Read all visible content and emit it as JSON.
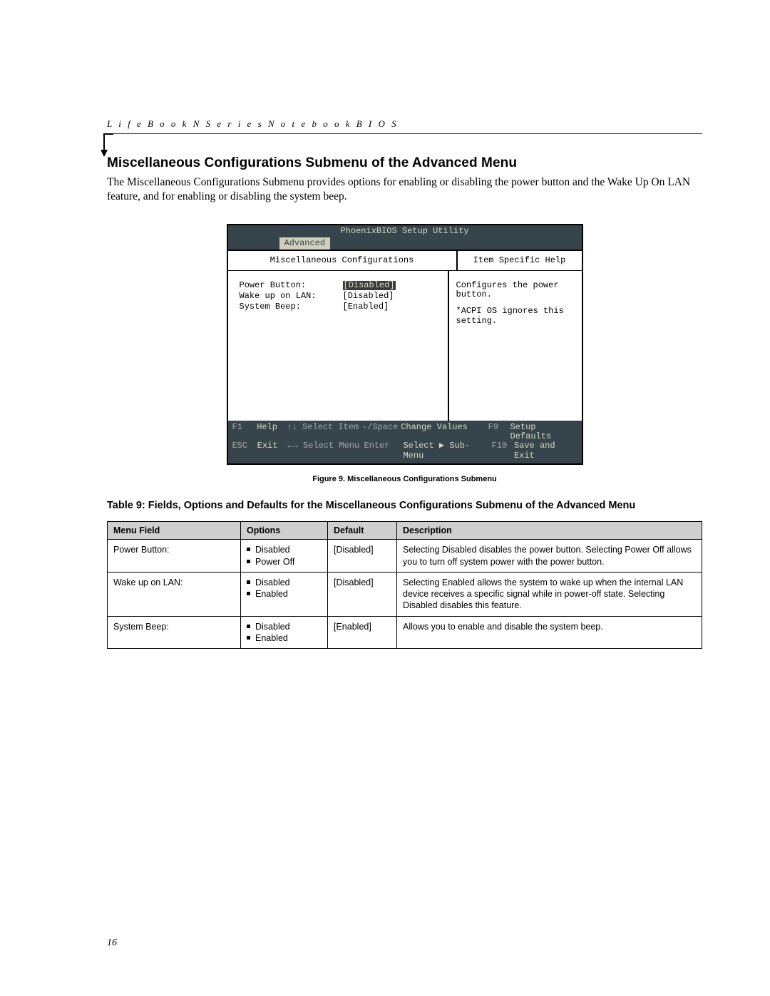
{
  "header": "L i f e B o o k   N   S e r i e s   N o t e b o o k   B I O S",
  "section_title": "Miscellaneous Configurations Submenu of the Advanced Menu",
  "section_body": "The Miscellaneous Configurations Submenu provides options for enabling or disabling the power button and the Wake Up On LAN feature, and for enabling or disabling the system beep.",
  "bios": {
    "title": "PhoenixBIOS Setup Utility",
    "active_tab": "Advanced",
    "panel_title_left": "Miscellaneous Configurations",
    "panel_title_right": "Item Specific Help",
    "rows": [
      {
        "label": "Power Button:",
        "value": "[Disabled]",
        "selected": true
      },
      {
        "label": "Wake up on LAN:",
        "value": "[Disabled]",
        "selected": false
      },
      {
        "label": "System Beep:",
        "value": "[Enabled]",
        "selected": false
      }
    ],
    "help_text_1": "Configures the power button.",
    "help_text_2": "*ACPI OS ignores this setting.",
    "foot": {
      "r1": {
        "k": "F1",
        "a": "Help",
        "b": "↑↓ Select Item",
        "c": "-/Space",
        "d": "Change Values",
        "e": "F9",
        "f": "Setup Defaults"
      },
      "r2": {
        "k": "ESC",
        "a": "Exit",
        "b": "←→ Select Menu",
        "c": "Enter",
        "d": "Select ▶ Sub-Menu",
        "e": "F10",
        "f": "Save and Exit"
      }
    }
  },
  "figure_caption": "Figure 9.  Miscellaneous Configurations Submenu",
  "table_title": "Table 9: Fields, Options and Defaults for the Miscellaneous Configurations Submenu of the Advanced Menu",
  "table": {
    "head": {
      "c1": "Menu Field",
      "c2": "Options",
      "c3": "Default",
      "c4": "Description"
    },
    "rows": [
      {
        "field": "Power Button:",
        "opts": [
          "Disabled",
          "Power Off"
        ],
        "def": "[Disabled]",
        "desc": "Selecting Disabled disables the power button. Selecting Power Off allows you to turn off system power with the power button."
      },
      {
        "field": "Wake up on LAN:",
        "opts": [
          "Disabled",
          "Enabled"
        ],
        "def": "[Disabled]",
        "desc": "Selecting Enabled allows the system to wake up when the internal LAN device receives a specific signal while in power-off state. Selecting Disabled disables this feature."
      },
      {
        "field": "System Beep:",
        "opts": [
          "Disabled",
          "Enabled"
        ],
        "def": "[Enabled]",
        "desc": "Allows you to enable and disable the system beep."
      }
    ]
  },
  "page_number": "16"
}
